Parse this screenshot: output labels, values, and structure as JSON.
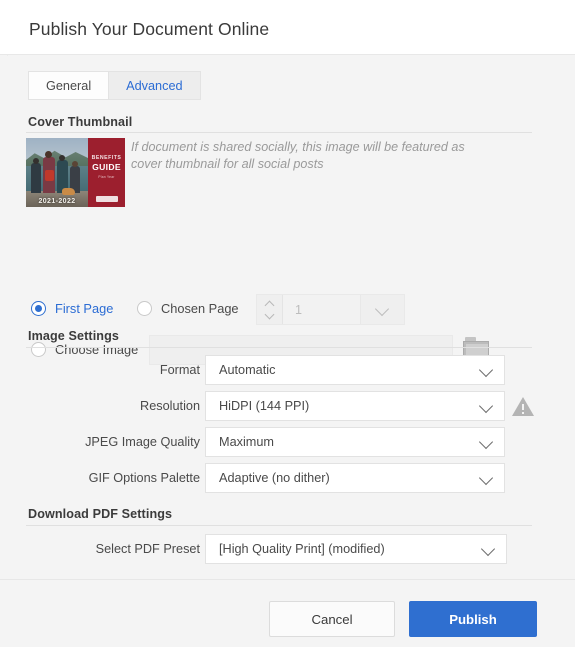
{
  "header": {
    "title": "Publish Your Document Online"
  },
  "tabs": [
    {
      "label": "General",
      "active": false
    },
    {
      "label": "Advanced",
      "active": true
    }
  ],
  "cover_thumbnail": {
    "section_title": "Cover Thumbnail",
    "note": "If document is shared socially, this image will be featured as cover thumbnail for all social posts",
    "preview": {
      "benefits_text": "BENEFITS",
      "guide_text": "GUIDE",
      "subtitle_text": "Plan Year",
      "year_text": "2021-2022"
    },
    "source_options": [
      {
        "label": "First Page",
        "selected": true
      },
      {
        "label": "Chosen Page",
        "selected": false
      },
      {
        "label": "Choose Image",
        "selected": false
      }
    ],
    "page_stepper": {
      "value": "1",
      "enabled": false
    },
    "choose_image_path": "",
    "browse_icon": "folder-icon"
  },
  "image_settings": {
    "section_title": "Image Settings",
    "rows": [
      {
        "label": "Format",
        "value": "Automatic",
        "warning": false
      },
      {
        "label": "Resolution",
        "value": "HiDPI (144 PPI)",
        "warning": true
      },
      {
        "label": "JPEG Image Quality",
        "value": "Maximum",
        "warning": false
      },
      {
        "label": "GIF Options Palette",
        "value": "Adaptive (no dither)",
        "warning": false
      }
    ],
    "warning_icon": "warning-triangle-icon"
  },
  "pdf_settings": {
    "section_title": "Download PDF Settings",
    "rows": [
      {
        "label": "Select PDF Preset",
        "value": "[High Quality Print] (modified)"
      }
    ]
  },
  "footer": {
    "cancel_label": "Cancel",
    "publish_label": "Publish"
  },
  "colors": {
    "accent_blue": "#2f6fd0",
    "body_bg": "#f4f4f4",
    "header_bg": "#ffffff",
    "brand_red": "#9c1f2e"
  }
}
